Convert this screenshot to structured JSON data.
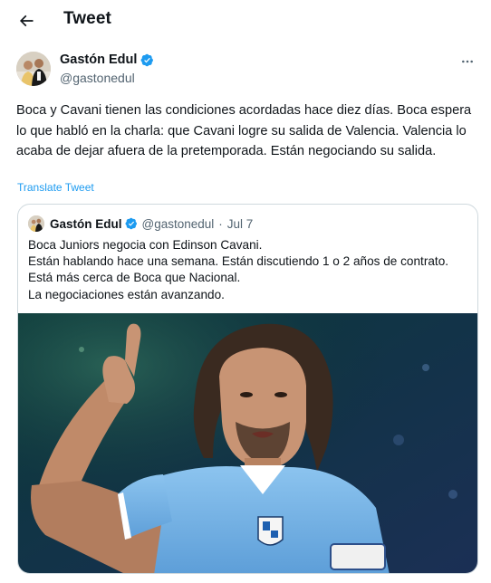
{
  "header": {
    "title": "Tweet"
  },
  "tweet": {
    "author_name": "Gastón Edul",
    "author_handle": "@gastonedul",
    "text": "Boca y Cavani tienen las condiciones acordadas hace diez días. Boca espera lo que habló en la charla: que Cavani logre su salida de Valencia. Valencia lo acaba de dejar afuera de la pretemporada. Están negociando su salida.",
    "translate_label": "Translate Tweet"
  },
  "quote": {
    "author_name": "Gastón Edul",
    "author_handle": "@gastonedul",
    "separator": "·",
    "date": "Jul 7",
    "lines": [
      "Boca Juniors negocia con Edinson Cavani.",
      "Están hablando hace una semana. Están discutiendo 1 o 2 años de contrato.",
      "Está más cerca de Boca que Nacional.",
      "La negociaciones están avanzando."
    ]
  },
  "colors": {
    "accent": "#1d9bf0",
    "secondary_text": "#536471",
    "border": "#cfd9de",
    "jersey": "#7cb6e6"
  },
  "icons": {
    "back": "arrow-left-icon",
    "verified": "verified-badge-icon",
    "more": "more-horizontal-icon"
  }
}
